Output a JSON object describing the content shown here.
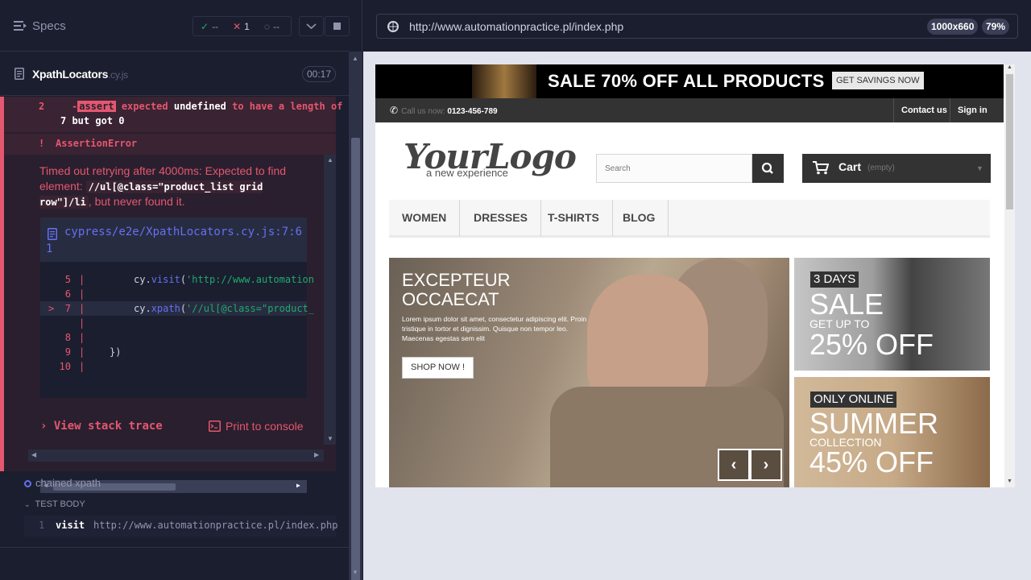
{
  "runner": {
    "header": {
      "title": "Specs"
    },
    "stats": {
      "passed": "--",
      "failed": "1",
      "pending": "--"
    },
    "spec": {
      "name": "XpathLocators",
      "ext": ".cy.js",
      "duration": "00:17"
    },
    "failure": {
      "assert_index": "2",
      "assert_keyword": "assert",
      "assert_text_1": "expected",
      "assert_value": "undefined",
      "assert_text_2": "to have a length of",
      "assert_text_3": "7 but got 0",
      "error_bang": "!",
      "error_name": "AssertionError",
      "message_pre": "Timed out retrying after 4000ms: Expected to find element: ",
      "message_code": "//ul[@class=\"product_list grid row\"]/li",
      "message_post": ", but never found it.",
      "frame_path_1": "cypress/e2e/XpathLocators.cy.js:7:6",
      "frame_path_2": "1",
      "code_lines": [
        {
          "no": "5",
          "code_a": "cy.",
          "code_fn": "visit",
          "code_b": "(",
          "code_str": "'http://www.automation",
          "highlight": false
        },
        {
          "no": "6",
          "code_a": "",
          "code_fn": "",
          "code_b": "",
          "code_str": "",
          "highlight": false
        },
        {
          "no": "7",
          "code_a": "cy.",
          "code_fn": "xpath",
          "code_b": "(",
          "code_str": "'//ul[@class=\"product_",
          "highlight": true
        },
        {
          "no": "",
          "code_a": "",
          "code_fn": "",
          "code_b": "",
          "code_str": "",
          "highlight": false
        },
        {
          "no": "8",
          "code_a": "",
          "code_fn": "",
          "code_b": "",
          "code_str": "",
          "highlight": false
        },
        {
          "no": "9",
          "code_a": "})",
          "code_fn": "",
          "code_b": "",
          "code_str": "",
          "highlight": false
        },
        {
          "no": "10",
          "code_a": "",
          "code_fn": "",
          "code_b": "",
          "code_str": "",
          "highlight": false
        }
      ],
      "view_stack_trace": "View stack trace",
      "print_to_console": "Print to console"
    },
    "test": {
      "title": "chained xpath",
      "body_label": "TEST BODY",
      "command_no": "1",
      "command": "visit",
      "command_arg": "http://www.automationpractice.pl/index.php"
    }
  },
  "preview": {
    "url": "http://www.automationpractice.pl/index.php",
    "viewport": "1000x660",
    "zoom": "79%"
  },
  "site": {
    "promo_text": "SALE 70% OFF ALL PRODUCTS",
    "promo_button": "GET SAVINGS NOW",
    "call_label": "Call us now:",
    "phone": "0123-456-789",
    "contact": "Contact us",
    "sign_in": "Sign in",
    "logo": "YourLogo",
    "logo_sub": "a new experience",
    "search_placeholder": "Search",
    "cart_label": "Cart",
    "cart_state": "(empty)",
    "menu": [
      "WOMEN",
      "DRESSES",
      "T-SHIRTS",
      "BLOG"
    ],
    "hero_title": "EXCEPTEUR OCCAECAT",
    "hero_text": "Lorem ipsum dolor sit amet, consectetur adipiscing elit. Proin tristique in tortor et dignissim. Quisque non tempor leo. Maecenas egestas sem elit",
    "hero_button": "SHOP NOW !",
    "banner1_tag": "3 DAYS",
    "banner1_big": "SALE",
    "banner1_small": "GET UP TO",
    "banner1_pct": "25% OFF",
    "banner2_tag": "ONLY ONLINE",
    "banner2_big": "SUMMER",
    "banner2_small": "COLLECTION",
    "banner2_pct": "45% OFF"
  },
  "colors": {
    "fail": "#e45770",
    "pass": "#1fa971",
    "link": "#6470f3",
    "bg": "#1b1e2e"
  },
  "icons": [
    "menu-icon",
    "check-icon",
    "x-icon",
    "spinner-icon",
    "chevron-down-icon",
    "stop-icon",
    "file-icon",
    "globe-icon",
    "phone-icon",
    "search-icon",
    "cart-icon",
    "terminal-icon"
  ]
}
